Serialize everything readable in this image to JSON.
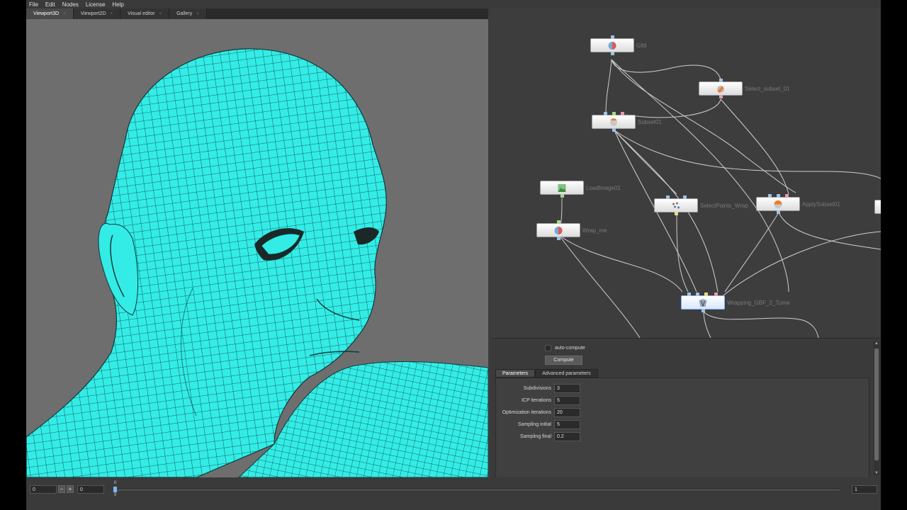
{
  "menu": {
    "items": [
      "File",
      "Edit",
      "Nodes",
      "License",
      "Help"
    ]
  },
  "viewport_tabs": [
    {
      "label": "Viewport3D",
      "active": true
    },
    {
      "label": "Viewport2D",
      "active": false
    },
    {
      "label": "Visual editor",
      "active": false
    },
    {
      "label": "Gallery",
      "active": false
    }
  ],
  "tab_close_glyph": "×",
  "mesh": {
    "color": "#33ece6",
    "wire_color": "#0d3b3b",
    "background": "#6e6e6e"
  },
  "nodes": [
    {
      "id": "gltfl",
      "label": "Glttl",
      "icon": "sphere-icon"
    },
    {
      "id": "select_subset",
      "label": "Select_subset_01",
      "icon": "brush-icon"
    },
    {
      "id": "subset",
      "label": "Subset01",
      "icon": "subset-icon"
    },
    {
      "id": "load_image",
      "label": "LoadImage01",
      "icon": "image-icon"
    },
    {
      "id": "select_points",
      "label": "SelectPoints_Wrap",
      "icon": "points-icon"
    },
    {
      "id": "apply_subset",
      "label": "ApplySubset01",
      "icon": "sphere-orange-icon"
    },
    {
      "id": "wrap_me",
      "label": "Wrap_me",
      "icon": "sphere-icon"
    },
    {
      "id": "wrapping",
      "label": "Wrapping_GBF_2_Tuma",
      "icon": "wrap-icon",
      "selected": true
    }
  ],
  "compute": {
    "auto_compute_label": "auto-compute",
    "auto_compute_checked": false,
    "button_label": "Compute"
  },
  "param_tabs": [
    {
      "label": "Parameters",
      "active": true
    },
    {
      "label": "Advanced parameters",
      "active": false
    }
  ],
  "parameters": [
    {
      "label": "Subdivisions",
      "value": "3"
    },
    {
      "label": "ICP iterations",
      "value": "5"
    },
    {
      "label": "Optimization iterations",
      "value": "20"
    },
    {
      "label": "Sampling initial",
      "value": "5"
    },
    {
      "label": "Sampling final",
      "value": "0.2"
    }
  ],
  "timeline": {
    "start": "0",
    "current": "0",
    "end": "1",
    "minus": "−",
    "plus": "+",
    "marker_top": "0",
    "marker_bottom": "0"
  }
}
